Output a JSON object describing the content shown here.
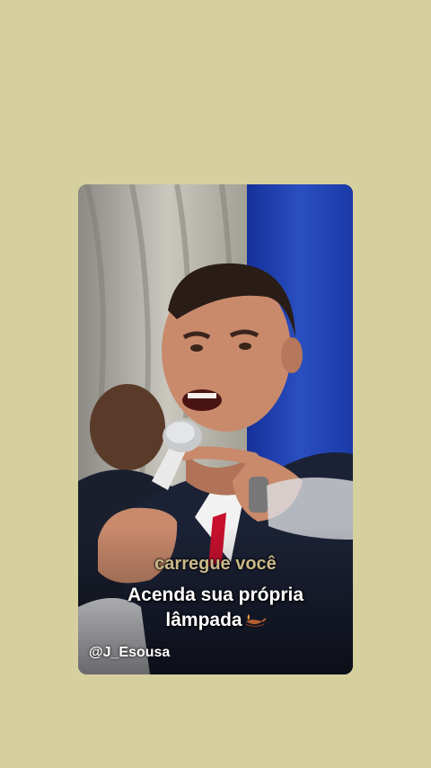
{
  "overlay": {
    "caption_previous": "carregue você",
    "caption_line1": "Acenda sua própria",
    "caption_line2": "lâmpada",
    "caption_emoji_icon": "oil-lamp-icon",
    "author_handle": "@J_Esousa"
  },
  "colors": {
    "page_background": "#d6d09e",
    "curtain_blue": "#1f3fa6",
    "suit_navy": "#1c2236",
    "tie_red": "#c8102e"
  }
}
